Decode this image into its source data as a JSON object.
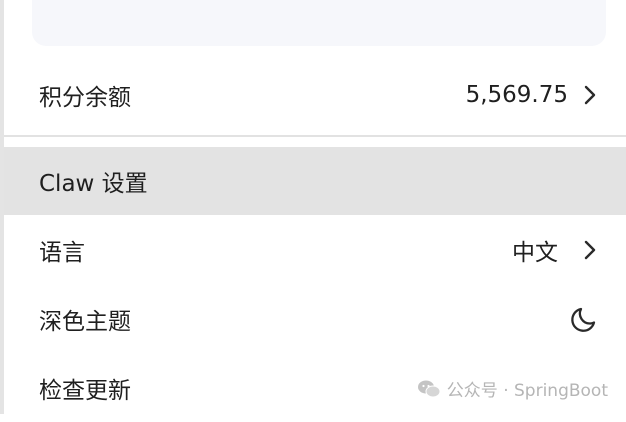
{
  "top_card": {
    "text": ""
  },
  "credits": {
    "label": "积分余额",
    "value": "5,569.75"
  },
  "claw_settings": {
    "label": "Claw 设置"
  },
  "language": {
    "label": "语言",
    "value": "中文"
  },
  "dark_theme": {
    "label": "深色主题"
  },
  "check_update": {
    "label": "检查更新"
  },
  "watermark": {
    "text": "公众号 · SpringBoot"
  },
  "colors": {
    "highlight_row": "#e3e3e3",
    "card_bg": "#f6f7fb",
    "divider": "#e2e2e2",
    "watermark": "#b5b5b5"
  },
  "icons": [
    "chevron-right-icon",
    "moon-icon",
    "wechat-icon"
  ]
}
